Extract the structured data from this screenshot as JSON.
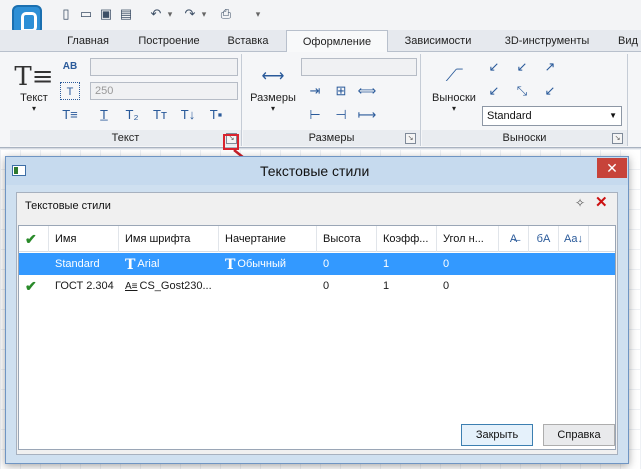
{
  "tabs": [
    "Главная",
    "Построение",
    "Вставка",
    "Оформление",
    "Зависимости",
    "3D-инструменты",
    "Вид"
  ],
  "active_tab": "Оформление",
  "ribbon": {
    "text_group": {
      "label": "Текст",
      "big_button": "Текст",
      "size_value": "250"
    },
    "dims_group": {
      "label": "Размеры",
      "big_button": "Размеры"
    },
    "callouts_group": {
      "label": "Выноски",
      "big_button": "Выноски",
      "style_select": "Standard"
    }
  },
  "dialog": {
    "title": "Текстовые стили",
    "panel_title": "Текстовые стили",
    "columns": [
      "Имя",
      "Имя шрифта",
      "Начертание",
      "Высота",
      "Коэфф...",
      "Угол н..."
    ],
    "rows": [
      {
        "name": "Standard",
        "font": "Arial",
        "style": "Обычный",
        "height": "0",
        "coef": "1",
        "angle": "0",
        "selected": true,
        "current": false
      },
      {
        "name": "ГОСТ 2.304",
        "font": "CS_Gost230...",
        "style": "",
        "height": "0",
        "coef": "1",
        "angle": "0",
        "selected": false,
        "current": true
      }
    ],
    "close_button": "Закрыть",
    "help_button": "Справка"
  }
}
